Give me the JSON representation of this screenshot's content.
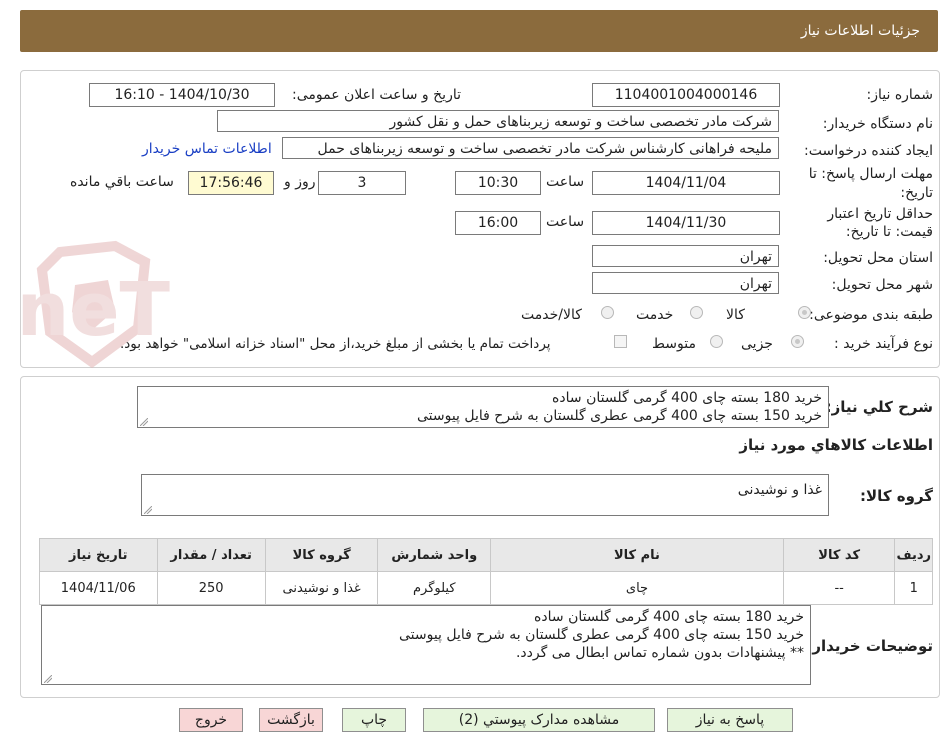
{
  "header": {
    "title": "جزئیات اطلاعات نیاز"
  },
  "fields": {
    "need_number_label": "شماره نیاز:",
    "need_number": "1104001004000146",
    "announce_label": "تاریخ و ساعت اعلان عمومی:",
    "announce_value": "1404/10/30 - 16:10",
    "buyer_org_label": "نام دستگاه خریدار:",
    "buyer_org": "شرکت مادر تخصصی ساخت و توسعه زیربناهای حمل و نقل کشور",
    "creator_label": "ایجاد کننده درخواست:",
    "creator": "ملیحه فراهانی کارشناس شرکت مادر تخصصی ساخت و توسعه زیربناهای حمل",
    "contact_link": "اطلاعات تماس خریدار",
    "deadline_label_1": "مهلت ارسال پاسخ: تا",
    "deadline_label_2": "تاریخ:",
    "deadline_date": "1404/11/04",
    "time_word": "ساعت",
    "deadline_time": "10:30",
    "days": "3",
    "days_word": "روز و",
    "remaining": "17:56:46",
    "remaining_word": "ساعت باقي مانده",
    "validity_label_1": "حداقل تاریخ اعتبار",
    "validity_label_2": "قیمت: تا تاریخ:",
    "validity_date": "1404/11/30",
    "validity_time": "16:00",
    "province_label": "استان محل تحویل:",
    "province": "تهران",
    "city_label": "شهر محل تحویل:",
    "city": "تهران",
    "category_label": "طبقه بندی موضوعی:",
    "category_options": [
      "کالا",
      "خدمت",
      "کالا/خدمت"
    ],
    "process_label": "نوع فرآیند خرید :",
    "process_options": [
      "جزیی",
      "متوسط"
    ],
    "payment_note": "پرداخت تمام یا بخشی از مبلغ خرید،از محل \"اسناد خزانه اسلامی\" خواهد بود."
  },
  "summary": {
    "label": "شرح کلي نياز:",
    "lines": [
      "خرید 180 بسته چای 400 گرمی گلستان ساده",
      "خرید 150 بسته چای 400 گرمی عطری گلستان به شرح فایل پیوستی"
    ]
  },
  "goods": {
    "section_title": "اطلاعات کالاهاي مورد نياز",
    "group_label": "گروه کالا:",
    "group_value": "غذا و نوشیدنی",
    "columns": [
      "رديف",
      "کد کالا",
      "نام کالا",
      "واحد شمارش",
      "گروه کالا",
      "تعداد / مقدار",
      "تاريخ نياز"
    ],
    "rows": [
      [
        "1",
        "--",
        "چای",
        "کیلوگرم",
        "غذا و نوشیدنی",
        "250",
        "1404/11/06"
      ]
    ]
  },
  "notes": {
    "label": "توضيحات خريدار:",
    "lines": [
      "خرید 180 بسته چای 400 گرمی گلستان ساده",
      "خرید 150 بسته چای 400 گرمی عطری گلستان به شرح فایل پیوستی",
      "** پیشنهادات بدون شماره تماس ابطال می گردد."
    ]
  },
  "buttons": {
    "reply": "پاسخ به نياز",
    "attachments": "مشاهده مدارک پيوستي (2)",
    "print": "چاپ",
    "back": "بازگشت",
    "exit": "خروج"
  },
  "watermark": {
    "text": "AriaTender.neT"
  },
  "colors": {
    "header": "#8b6b3d",
    "link": "#1a3fc4",
    "highlight": "#fffbd2",
    "watermark": "#e9c9c9"
  }
}
